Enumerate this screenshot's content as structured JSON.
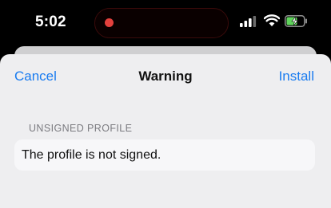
{
  "status_bar": {
    "time": "5:02",
    "recording_color": "#e3413d",
    "icons": [
      "signal-icon",
      "wifi-icon",
      "battery-charging-icon"
    ]
  },
  "nav": {
    "cancel_label": "Cancel",
    "title": "Warning",
    "install_label": "Install",
    "accent_color": "#1a7cf0"
  },
  "section": {
    "header": "UNSIGNED PROFILE",
    "message": "The profile is not signed."
  }
}
